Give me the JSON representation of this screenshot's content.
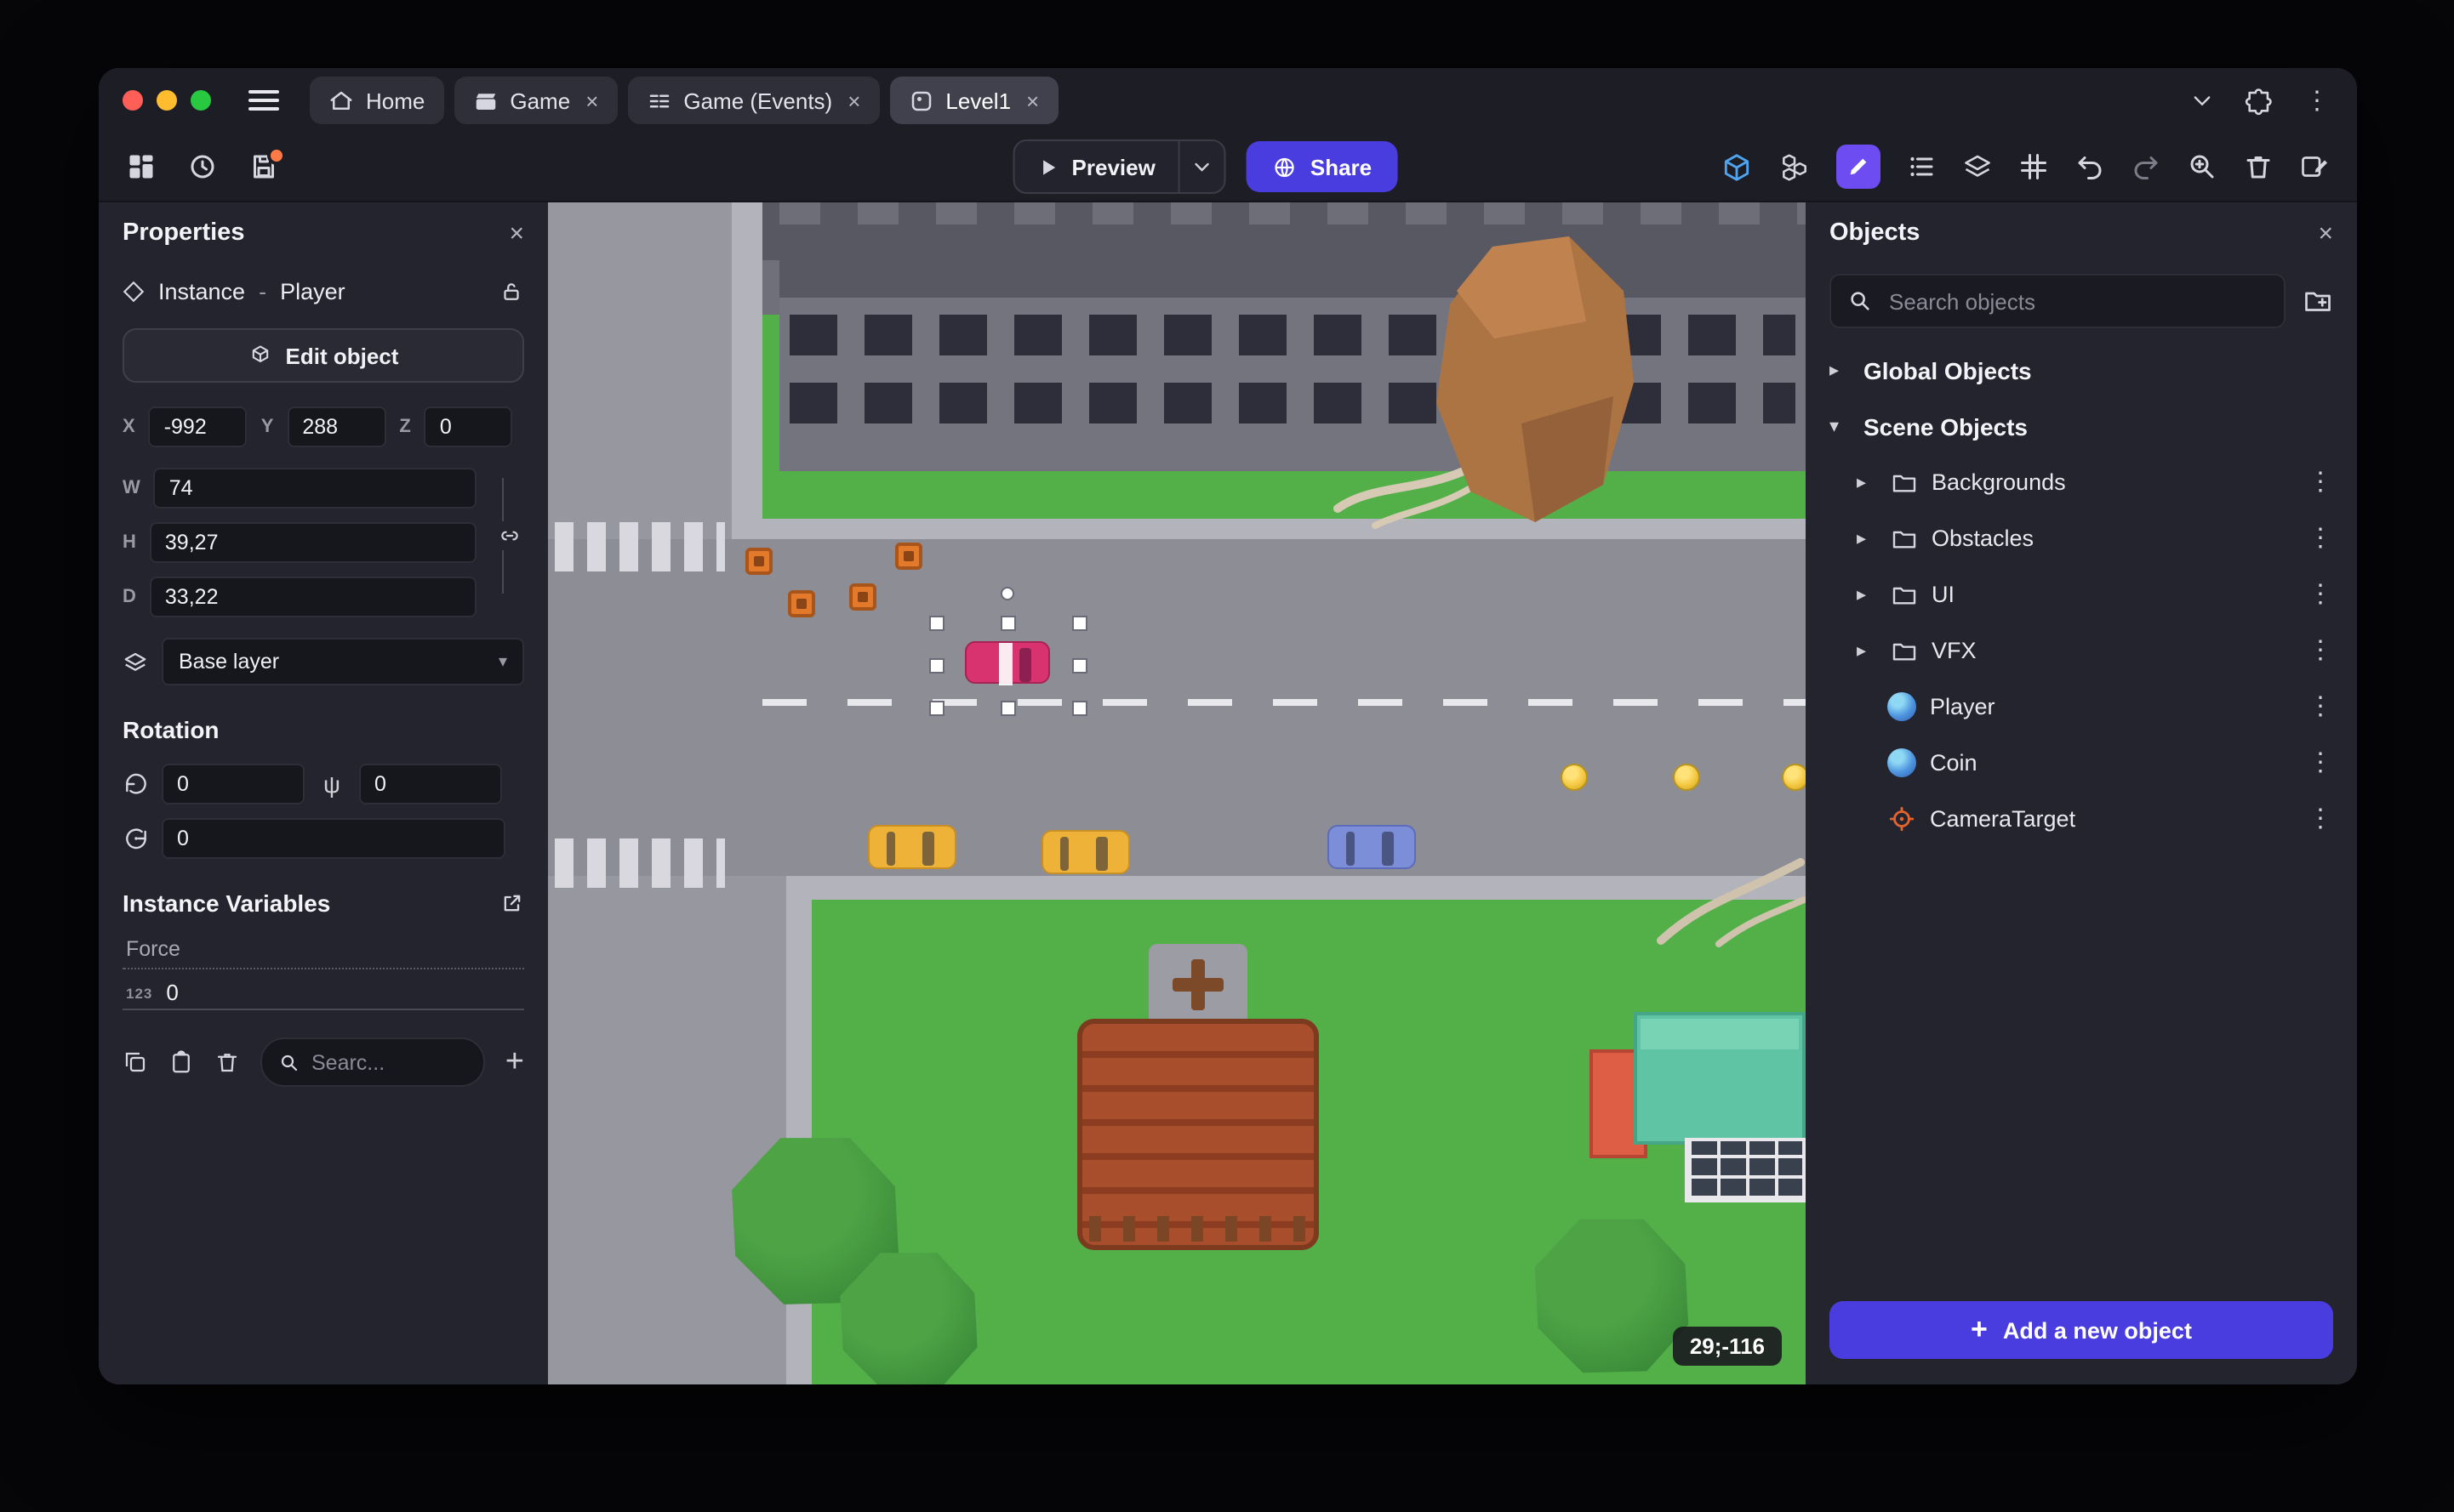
{
  "glyphs": {
    "close": "×",
    "kebab": "⋮",
    "chevron_down": "▾",
    "chevron_right": "▸",
    "undo": "↶",
    "redo": "↷",
    "plus": "+",
    "psi": "ψ"
  },
  "colors": {
    "accent_purple": "#4a3de0",
    "active_tool_purple": "#6d4cf2",
    "view3d_blue": "#4fa4f0",
    "unsaved_dot_orange": "#ff7a45",
    "traffic_red": "#ff5f57",
    "traffic_yellow": "#febc2e",
    "traffic_green": "#28c840"
  },
  "chrome": {
    "tabs": [
      {
        "label": "Home"
      },
      {
        "label": "Game"
      },
      {
        "label": "Game (Events)"
      },
      {
        "label": "Level1"
      }
    ]
  },
  "toolbar": {
    "preview_label": "Preview",
    "share_label": "Share"
  },
  "properties": {
    "title": "Properties",
    "instance_label": "Instance",
    "separator": "-",
    "object_name": "Player",
    "edit_object": "Edit object",
    "x_label": "X",
    "x": "-992",
    "y_label": "Y",
    "y": "288",
    "z_label": "Z",
    "z": "0",
    "w_label": "W",
    "w": "74",
    "h_label": "H",
    "h": "39,27",
    "d_label": "D",
    "d": "33,22",
    "layer": "Base layer",
    "rotation_title": "Rotation",
    "rot_x": "0",
    "rot_y": "0",
    "rot_z": "0",
    "variables_title": "Instance Variables",
    "variable_name": "Force",
    "variable_type_badge": "123",
    "variable_value": "0",
    "search_placeholder": "Searc..."
  },
  "canvas": {
    "coordinates": "29;-116"
  },
  "objects": {
    "title": "Objects",
    "search_placeholder": "Search objects",
    "global_label": "Global Objects",
    "scene_label": "Scene Objects",
    "folders": [
      {
        "label": "Backgrounds"
      },
      {
        "label": "Obstacles"
      },
      {
        "label": "UI"
      },
      {
        "label": "VFX"
      }
    ],
    "items": [
      {
        "label": "Player"
      },
      {
        "label": "Coin"
      },
      {
        "label": "CameraTarget"
      }
    ],
    "add_label": "Add a new object"
  }
}
